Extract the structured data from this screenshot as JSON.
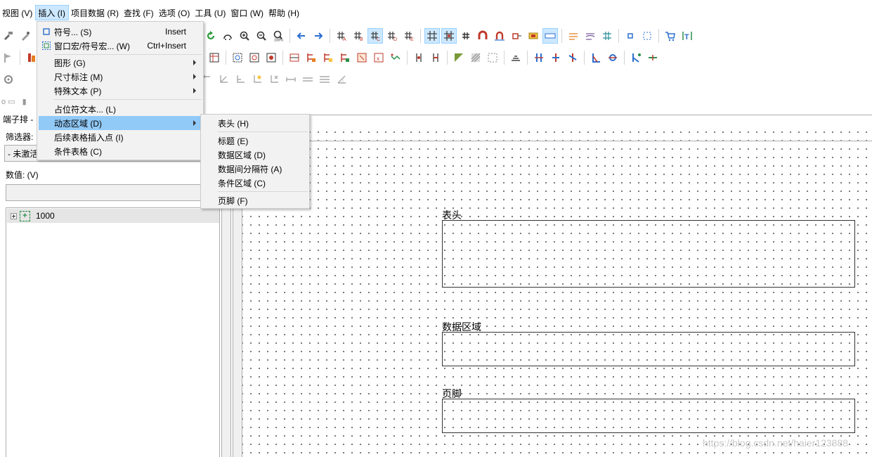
{
  "menubar": {
    "items": [
      {
        "label": "视图 (V)"
      },
      {
        "label": "插入 (I)"
      },
      {
        "label": "项目数据 (R)"
      },
      {
        "label": "查找 (F)"
      },
      {
        "label": "选项 (O)"
      },
      {
        "label": "工具 (U)"
      },
      {
        "label": "窗口 (W)"
      },
      {
        "label": "帮助 (H)"
      }
    ]
  },
  "insert_menu": {
    "items": [
      {
        "label": "符号... (S)",
        "shortcut": "Insert",
        "icon": "symbol-icon"
      },
      {
        "label": "窗口宏/符号宏... (W)",
        "shortcut": "Ctrl+Insert",
        "icon": "window-macro-icon"
      },
      {
        "label": "图形 (G)",
        "submenu": true
      },
      {
        "label": "尺寸标注 (M)",
        "submenu": true
      },
      {
        "label": "特殊文本 (P)",
        "submenu": true
      },
      {
        "label": "占位符文本... (L)"
      },
      {
        "label": "动态区域 (D)",
        "submenu": true
      },
      {
        "label": "后续表格插入点 (I)"
      },
      {
        "label": "条件表格 (C)"
      }
    ]
  },
  "dynamic_submenu": {
    "items": [
      {
        "label": "表头 (H)"
      },
      {
        "label": "标题 (E)"
      },
      {
        "label": "数据区域 (D)"
      },
      {
        "label": "数据间分隔符 (A)"
      },
      {
        "label": "条件区域 (C)"
      },
      {
        "label": "页脚 (F)"
      }
    ]
  },
  "left_panel": {
    "title": "端子排 - ",
    "filter_label": "筛选器:",
    "filter_value": "- 未激活",
    "value_label": "数值: (V)",
    "tree": {
      "node": "1000"
    }
  },
  "canvas": {
    "header_label": "表头",
    "data_label": "数据区域",
    "footer_label": "页脚"
  },
  "watermark": "https://blog.csdn.net/haier123888",
  "colors": {
    "menu_highlight": "#91c9f7",
    "active_top": "#cce8ff"
  }
}
